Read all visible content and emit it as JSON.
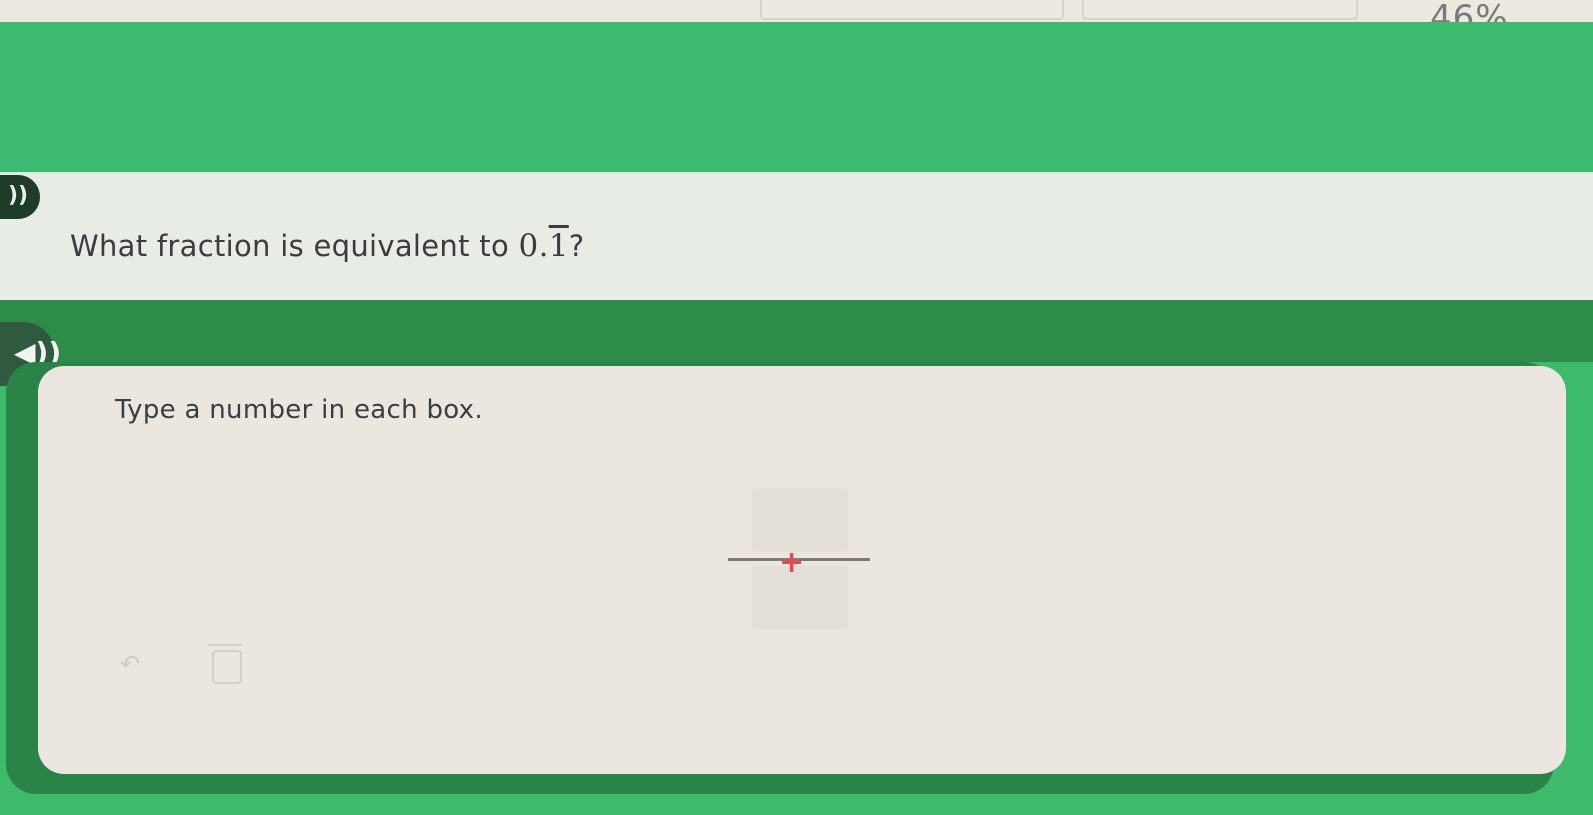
{
  "progress": {
    "percent_label": "46%",
    "value": 0.46
  },
  "question": {
    "prefix": "What fraction is equivalent to",
    "repeating_decimal_leading": "0.",
    "repeating_decimal_digit": "1",
    "suffix": "?"
  },
  "instruction": {
    "text": "Type a number in each box."
  },
  "icons": {
    "audio": "speaker-icon",
    "undo": "undo-icon",
    "delete": "trash-icon"
  },
  "colors": {
    "accent_green": "#3cbb70",
    "dark_green": "#2e8c4b",
    "cursor_red": "#e8464b"
  }
}
